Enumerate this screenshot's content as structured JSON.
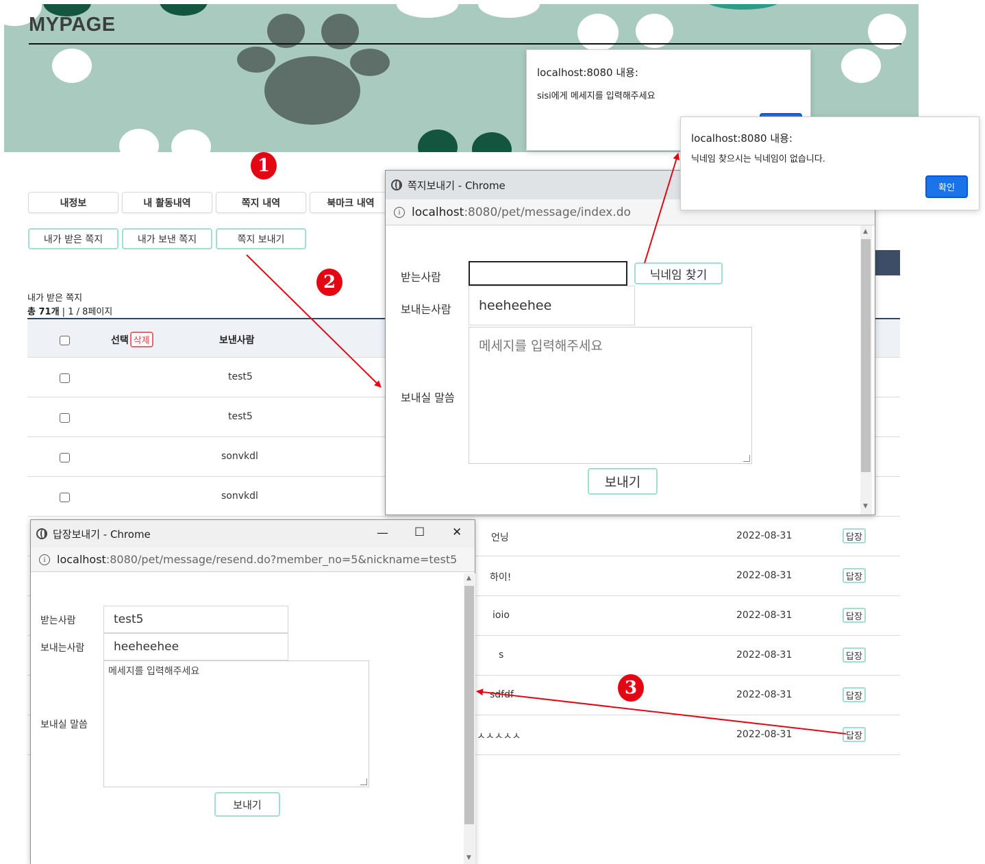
{
  "banner": {
    "title": "MYPAGE"
  },
  "tabs": [
    {
      "label": "내정보"
    },
    {
      "label": "내 활동내역"
    },
    {
      "label": "쪽지 내역"
    },
    {
      "label": "북마크 내역"
    }
  ],
  "subtabs": [
    {
      "label": "내가 받은 쪽지"
    },
    {
      "label": "내가 보낸 쪽지"
    },
    {
      "label": "쪽지 보내기"
    }
  ],
  "section": {
    "title": "내가 받은 쪽지",
    "count_bold": "총 71개",
    "count_rest": " | 1 / 8페이지"
  },
  "table": {
    "header": {
      "select": "선택",
      "delete": "삭제",
      "sender": "보낸사람"
    },
    "rows_visible": [
      {
        "sender": "test5"
      },
      {
        "sender": "test5"
      },
      {
        "sender": "sonvkdl"
      },
      {
        "sender": "sonvkdl"
      }
    ],
    "rows_right": [
      {
        "title": "언닝",
        "date": "2022-08-31",
        "reply": "답장"
      },
      {
        "title": "하이!",
        "date": "2022-08-31",
        "reply": "답장"
      },
      {
        "title": "ioio",
        "date": "2022-08-31",
        "reply": "답장"
      },
      {
        "title": "s",
        "date": "2022-08-31",
        "reply": "답장"
      },
      {
        "title": "sdfdf",
        "date": "2022-08-31",
        "reply": "답장"
      },
      {
        "title": "ㅅㅅㅅㅅㅅ",
        "date": "2022-08-31",
        "reply": "답장"
      }
    ]
  },
  "send_window": {
    "title": "쪽지보내기 - Chrome",
    "url_host": "localhost",
    "url_rest": ":8080/pet/message/index.do",
    "labels": {
      "to": "받는사람",
      "from": "보내는사람",
      "message": "보내실 말씀"
    },
    "to_value": "",
    "find_button": "닉네임 찾기",
    "from_value": "heeheehee",
    "message_placeholder": "메세지를 입력해주세요",
    "send_button": "보내기"
  },
  "reply_window": {
    "title": "답장보내기 - Chrome",
    "controls": {
      "minimize": "—",
      "maximize": "☐",
      "close": "✕"
    },
    "url_host": "localhost",
    "url_rest": ":8080/pet/message/resend.do?member_no=5&nickname=test5",
    "labels": {
      "to": "받는사람",
      "from": "보내는사람",
      "message": "보내실 말씀"
    },
    "to_value": "test5",
    "from_value": "heeheehee",
    "message_placeholder": "메세지를 입력해주세요",
    "send_button": "보내기"
  },
  "alert1": {
    "origin": "localhost:8080 내용:",
    "message": "sisi에게 메세지를 입력해주세요"
  },
  "alert2": {
    "origin": "localhost:8080 내용:",
    "message": "닉네임 찾으시는 닉네임이 없습니다.",
    "ok": "확인"
  },
  "steps": [
    "1",
    "2",
    "3"
  ],
  "colors": {
    "banner": "#a9cbbf",
    "mint_border": "#9fe0cf",
    "accent_red": "#e30613",
    "header_navy": "#35455c",
    "alert_blue": "#1a73e8"
  }
}
